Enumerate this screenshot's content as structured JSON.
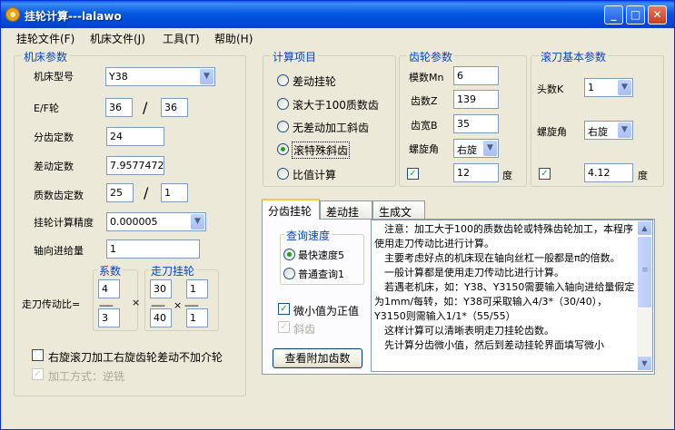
{
  "window": {
    "title": "挂轮计算---lalawo",
    "minimize": "_",
    "maximize": "□",
    "close": "✕"
  },
  "menu": [
    "挂轮文件(F)",
    "机床文件(J)",
    "工具(T)",
    "帮助(H)"
  ],
  "machine": {
    "legend": "机床参数",
    "model_label": "机床型号",
    "model_value": "Y38",
    "ef_label": "E/F轮",
    "ef_e": "36",
    "ef_f": "36",
    "slash": "/",
    "index_label": "分齿定数",
    "index_value": "24",
    "diff_label": "差动定数",
    "diff_value": "7.9577472",
    "prime_label": "质数齿定数",
    "prime_a": "25",
    "prime_b": "1",
    "precision_label": "挂轮计算精度",
    "precision_value": "0.000005",
    "feed_label": "轴向进给量",
    "feed_value": "1",
    "coef_legend": "系数",
    "coef_top": "4",
    "coef_bottom": "3",
    "walk_legend": "走刀挂轮",
    "walk_a": "30",
    "walk_b": "1",
    "walk_c": "40",
    "walk_d": "1",
    "ratio_label": "走刀传动比=",
    "dash": "-----",
    "times": "×",
    "right_hob_label": "右旋滚刀加工右旋齿轮差动不加介轮",
    "machining_label": "加工方式：逆铣"
  },
  "calc": {
    "legend": "计算项目",
    "items": [
      "差动挂轮",
      "滚大于100质数齿",
      "无差动加工斜齿",
      "滚特殊斜齿",
      "比值计算"
    ],
    "selected_index": 3
  },
  "gear": {
    "legend": "齿轮参数",
    "module_label": "模数Mn",
    "module_value": "6",
    "teeth_label": "齿数Z",
    "teeth_value": "139",
    "width_label": "齿宽B",
    "width_value": "35",
    "helix_label": "螺旋角",
    "helix_value": "右旋",
    "angle_value": "12",
    "degree": "度",
    "checked": "✓"
  },
  "hob": {
    "legend": "滚刀基本参数",
    "starts_label": "头数K",
    "starts_value": "1",
    "helix_label": "螺旋角",
    "helix_value": "右旋",
    "angle_value": "4.12",
    "degree": "度",
    "checked": "✓"
  },
  "tabs": [
    "分齿挂轮",
    "差动挂轮",
    "生成文件"
  ],
  "query": {
    "legend": "查询速度",
    "fast": "最快速度5",
    "normal": "普通查询1",
    "small_positive": "微小值为正值",
    "helical": "斜齿",
    "button": "查看附加齿数"
  },
  "notes": [
    "　注意：加工大于100的质数齿轮或特殊齿轮加工，本程序使用走刀传动比进行计算。",
    "　主要考虑好点的机床现在轴向丝杠一般都是π的倍数。",
    "　一般计算都是使用走刀传动比进行计算。",
    "　若遇老机床，如：Y38、Y3150需要输入轴向进给量假定为1mm/每转，如：Y38可采取输入4/3*（30/40），Y3150则需输入1/1*（55/55）",
    "　这样计算可以清晰表明走刀挂轮齿数。",
    "　先计算分齿微小值，然后到差动挂轮界面填写微小"
  ],
  "scroll": {
    "up": "▲",
    "down": "▼",
    "grip": "≡"
  },
  "icons": {
    "dropdown": "▼"
  }
}
